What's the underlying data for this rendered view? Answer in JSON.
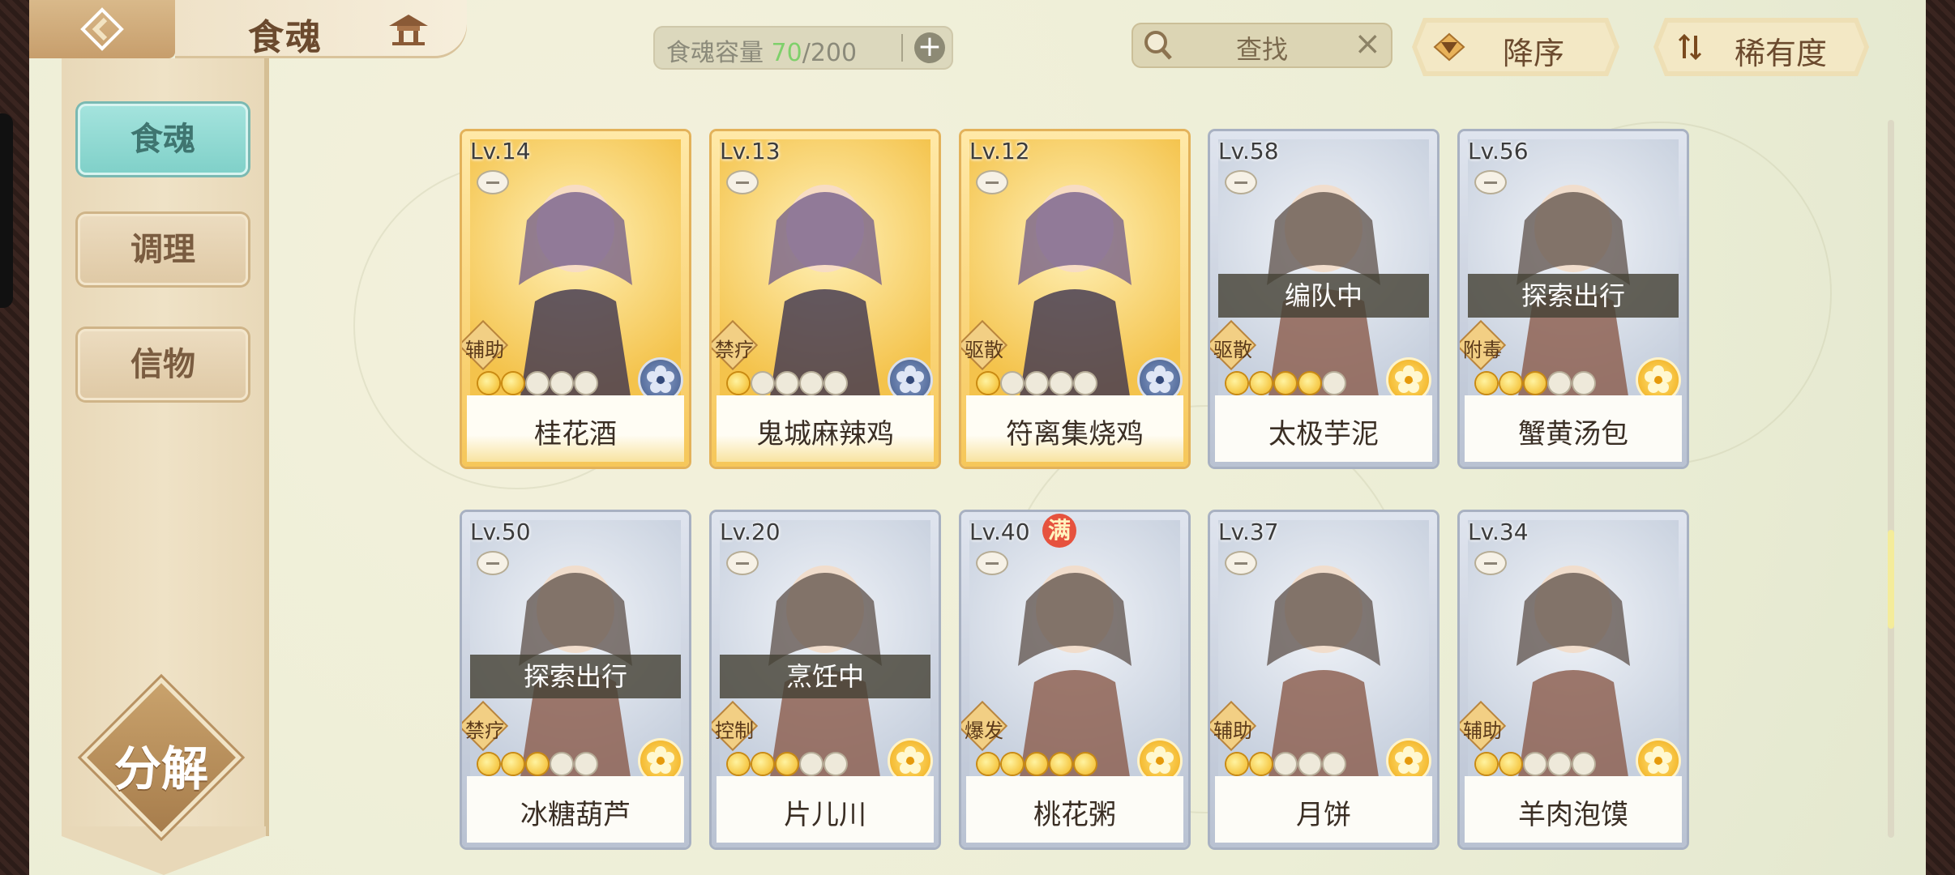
{
  "header": {
    "title": "食魂",
    "capacity": {
      "label": "食魂容量",
      "used": "70",
      "total": "/200",
      "add": "+"
    },
    "search": {
      "placeholder": "查找",
      "clear": "×"
    },
    "sort_order": "降序",
    "sort_field": "稀有度"
  },
  "sidebar": {
    "tabs": [
      {
        "label": "食魂",
        "active": true
      },
      {
        "label": "调理",
        "active": false
      },
      {
        "label": "信物",
        "active": false
      }
    ],
    "decompose": "分解"
  },
  "colors": {
    "accent_teal": "#7fd0c8",
    "gold_card": "#f6c75a",
    "silver_card": "#b9c2d2",
    "capacity_used": "#7fd06b"
  },
  "cards": [
    {
      "level": "Lv.14",
      "name": "桂花酒",
      "role": "辅助",
      "status": "",
      "stars_on": 2,
      "rarity": "gold",
      "emblem": "blue",
      "full": ""
    },
    {
      "level": "Lv.13",
      "name": "鬼城麻辣鸡",
      "role": "禁疗",
      "status": "",
      "stars_on": 1,
      "rarity": "gold",
      "emblem": "blue",
      "full": ""
    },
    {
      "level": "Lv.12",
      "name": "符离集烧鸡",
      "role": "驱散",
      "status": "",
      "stars_on": 1,
      "rarity": "gold",
      "emblem": "blue",
      "full": ""
    },
    {
      "level": "Lv.58",
      "name": "太极芋泥",
      "role": "驱散",
      "status": "编队中",
      "stars_on": 4,
      "rarity": "silver",
      "emblem": "gold",
      "full": ""
    },
    {
      "level": "Lv.56",
      "name": "蟹黄汤包",
      "role": "附毒",
      "status": "探索出行",
      "stars_on": 3,
      "rarity": "silver",
      "emblem": "gold",
      "full": ""
    },
    {
      "level": "Lv.50",
      "name": "冰糖葫芦",
      "role": "禁疗",
      "status": "探索出行",
      "stars_on": 3,
      "rarity": "silver",
      "emblem": "gold",
      "full": ""
    },
    {
      "level": "Lv.20",
      "name": "片儿川",
      "role": "控制",
      "status": "烹饪中",
      "stars_on": 3,
      "rarity": "silver",
      "emblem": "gold",
      "full": ""
    },
    {
      "level": "Lv.40",
      "name": "桃花粥",
      "role": "爆发",
      "status": "",
      "stars_on": 5,
      "rarity": "silver",
      "emblem": "gold",
      "full": "满"
    },
    {
      "level": "Lv.37",
      "name": "月饼",
      "role": "辅助",
      "status": "",
      "stars_on": 2,
      "rarity": "silver",
      "emblem": "gold",
      "full": ""
    },
    {
      "level": "Lv.34",
      "name": "羊肉泡馍",
      "role": "辅助",
      "status": "",
      "stars_on": 2,
      "rarity": "silver",
      "emblem": "gold",
      "full": ""
    }
  ]
}
